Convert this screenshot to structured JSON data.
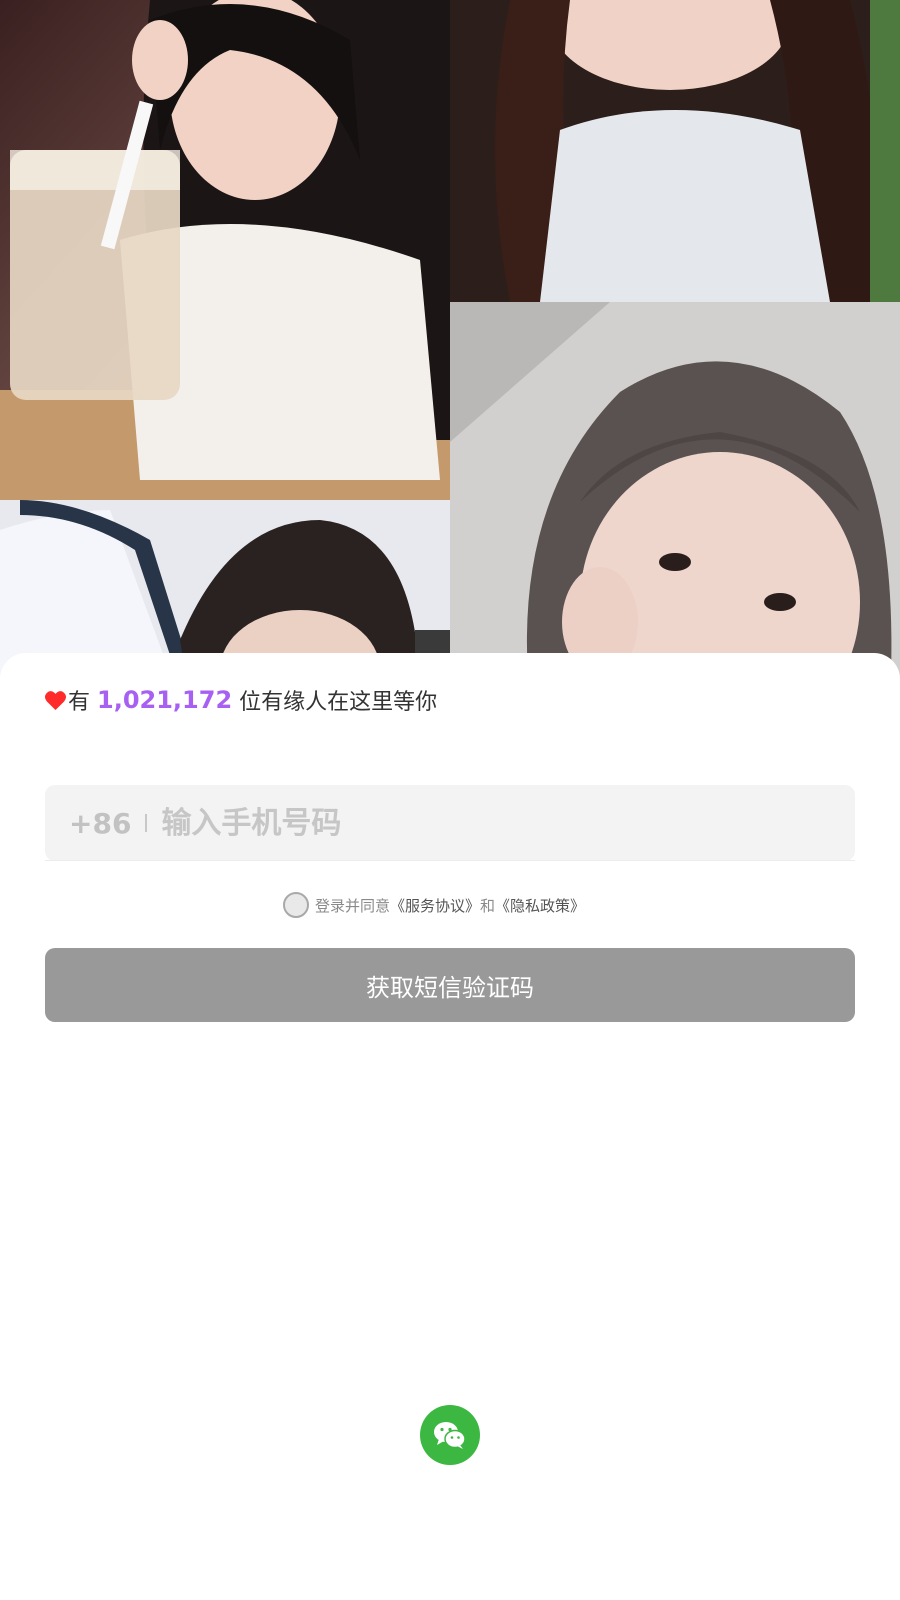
{
  "header": {
    "photos": [
      {
        "name": "photo-girl-milk-tea"
      },
      {
        "name": "photo-girl-long-hair"
      },
      {
        "name": "photo-girl-hand-face"
      },
      {
        "name": "photo-girl-car"
      }
    ]
  },
  "stats": {
    "prefix": "有",
    "count": "1,021,172",
    "suffix": "位有缘人在这里等你",
    "heart_color": "#ff2a2a",
    "count_color": "#a760f2"
  },
  "phone": {
    "country_code": "+86",
    "placeholder": "输入手机号码",
    "value": ""
  },
  "agreement": {
    "checked": false,
    "prefix": "登录并同意",
    "service_link": "《服务协议》",
    "and": "和",
    "privacy_link": "《隐私政策》"
  },
  "sms_button": {
    "label": "获取短信验证码",
    "color": "#999999"
  },
  "wechat": {
    "icon": "wechat-icon",
    "color": "#3cb742"
  }
}
